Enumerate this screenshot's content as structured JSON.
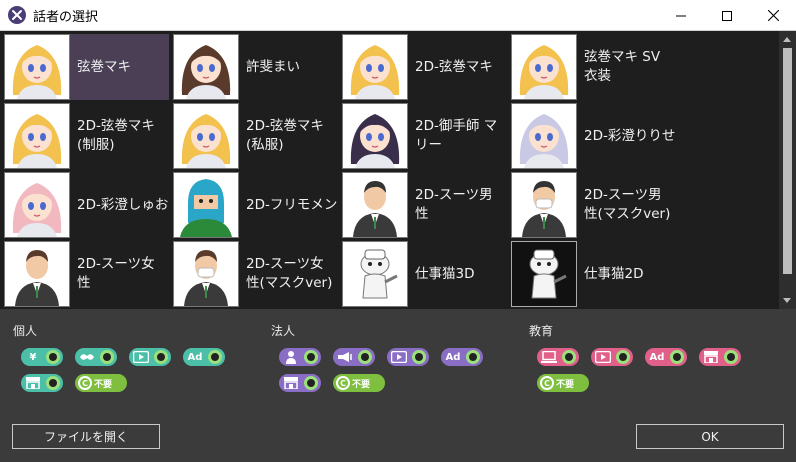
{
  "window": {
    "title": "話者の選択",
    "minimize_icon": "minimize-icon",
    "maximize_icon": "maximize-icon",
    "close_icon": "close-icon"
  },
  "speakers": [
    {
      "name": "弦巻マキ",
      "selected": true
    },
    {
      "name": "許斐まい",
      "selected": false
    },
    {
      "name": "2D-弦巻マキ",
      "selected": false
    },
    {
      "name": "弦巻マキ SV\n衣装",
      "selected": false
    },
    {
      "name": "2D-弦巻マキ\n(制服)",
      "selected": false
    },
    {
      "name": "2D-弦巻マキ\n(私服)",
      "selected": false
    },
    {
      "name": "2D-御手師 マ\nリー",
      "selected": false
    },
    {
      "name": "2D-彩澄りりせ",
      "selected": false
    },
    {
      "name": "2D-彩澄しゅお",
      "selected": false
    },
    {
      "name": "2D-フリモメン",
      "selected": false
    },
    {
      "name": "2D-スーツ男\n性",
      "selected": false
    },
    {
      "name": "2D-スーツ男\n性(マスクver)",
      "selected": false
    },
    {
      "name": "2D-スーツ女\n性",
      "selected": false
    },
    {
      "name": "2D-スーツ女\n性(マスクver)",
      "selected": false
    },
    {
      "name": "仕事猫3D",
      "selected": false
    },
    {
      "name": "仕事猫2D",
      "selected": false
    }
  ],
  "license": {
    "personal": {
      "title": "個人"
    },
    "corporate": {
      "title": "法人"
    },
    "education": {
      "title": "教育"
    },
    "not_required_label": "不要",
    "ad_label": "Ad",
    "yen_label": "¥",
    "colors": {
      "personal": "#4bbfa8",
      "corporate": "#8a6ec5",
      "education": "#e0608a",
      "credit": "#7fbf3f",
      "knob_ring": "#9be07a"
    }
  },
  "buttons": {
    "open_file": "ファイルを開く",
    "ok": "OK"
  }
}
